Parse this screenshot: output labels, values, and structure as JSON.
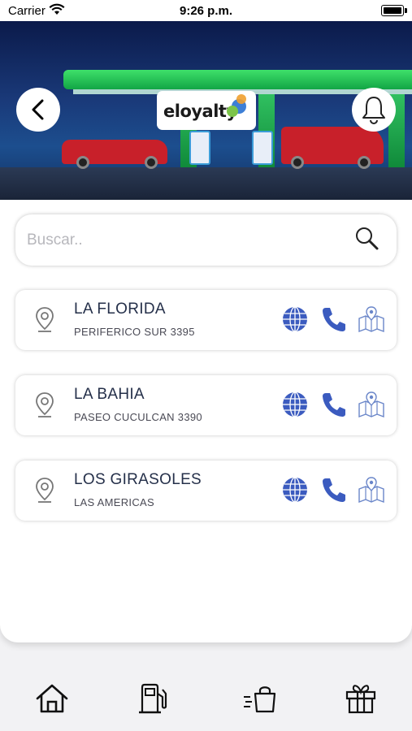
{
  "status_bar": {
    "carrier": "Carrier",
    "time": "9:26 p.m."
  },
  "header": {
    "brand": "eloyalty"
  },
  "search": {
    "placeholder": "Buscar.."
  },
  "stations": [
    {
      "name": "LA FLORIDA",
      "address": "PERIFERICO SUR 3395"
    },
    {
      "name": "LA BAHIA",
      "address": "PASEO CUCULCAN 3390"
    },
    {
      "name": "LOS GIRASOLES",
      "address": "LAS AMERICAS"
    }
  ],
  "tabbar": {
    "items": [
      "home-icon",
      "fuel-pump-icon",
      "shopping-bag-icon",
      "gift-icon"
    ]
  },
  "colors": {
    "accent_blue": "#3b5bbf",
    "title": "#25304a",
    "brand_green": "#7cc44a",
    "brand_blue": "#3d7fd6"
  }
}
